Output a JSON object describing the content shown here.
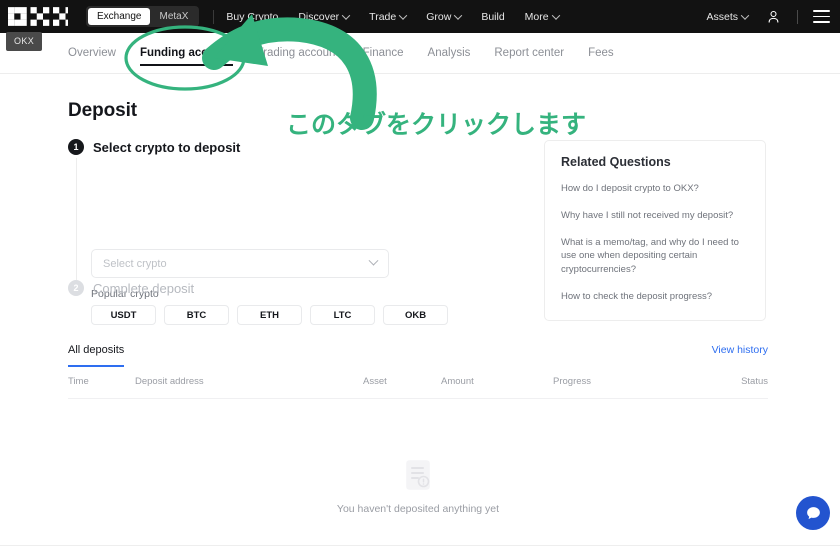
{
  "topnav": {
    "logo_alt": "OKX",
    "segments": [
      {
        "label": "Exchange",
        "active": true
      },
      {
        "label": "MetaX",
        "active": false
      }
    ],
    "links": [
      {
        "label": "Buy Crypto",
        "caret": false
      },
      {
        "label": "Discover",
        "caret": true
      },
      {
        "label": "Trade",
        "caret": true
      },
      {
        "label": "Grow",
        "caret": true
      },
      {
        "label": "Build",
        "caret": false
      },
      {
        "label": "More",
        "caret": true
      }
    ],
    "assets_label": "Assets",
    "account_icon": "person-icon",
    "menu_icon": "hamburger-menu-icon"
  },
  "tooltip": {
    "text": "OKX"
  },
  "subnav": {
    "tabs": [
      {
        "label": "Overview",
        "active": false
      },
      {
        "label": "Funding account",
        "active": true
      },
      {
        "label": "Trading account",
        "active": false
      },
      {
        "label": "Finance",
        "active": false
      },
      {
        "label": "Analysis",
        "active": false
      },
      {
        "label": "Report center",
        "active": false
      },
      {
        "label": "Fees",
        "active": false
      }
    ]
  },
  "main": {
    "title": "Deposit",
    "step1": {
      "number": "1",
      "label": "Select crypto to deposit"
    },
    "step2": {
      "number": "2",
      "label": "Complete deposit"
    },
    "select": {
      "placeholder": "Select crypto",
      "caret_icon": "chevron-down-icon"
    },
    "popular_label": "Popular crypto",
    "popular_chips": [
      "USDT",
      "BTC",
      "ETH",
      "LTC",
      "OKB"
    ]
  },
  "related_questions": {
    "title": "Related Questions",
    "items": [
      "How do I deposit crypto to OKX?",
      "Why have I still not received my deposit?",
      "What is a memo/tag, and why do I need to use one when depositing certain cryptocurrencies?",
      "How to check the deposit progress?"
    ]
  },
  "deposits": {
    "tab_label": "All deposits",
    "view_history_label": "View history",
    "columns": [
      "Time",
      "Deposit address",
      "Asset",
      "Amount",
      "Progress",
      "Status"
    ],
    "rows": [],
    "empty_text": "You haven't deposited anything yet",
    "empty_icon": "empty-document-icon"
  },
  "chat": {
    "icon": "chat-bubble-icon"
  },
  "annotation": {
    "text": "このタブをクリックします",
    "color": "#35b37e",
    "shapes": [
      "ellipse-highlight",
      "curved-arrow"
    ]
  },
  "colors": {
    "nav_bg": "#121212",
    "accent_blue": "#2e6ef0",
    "annotation_green": "#35b37e",
    "chat_blue": "#2354cf"
  }
}
